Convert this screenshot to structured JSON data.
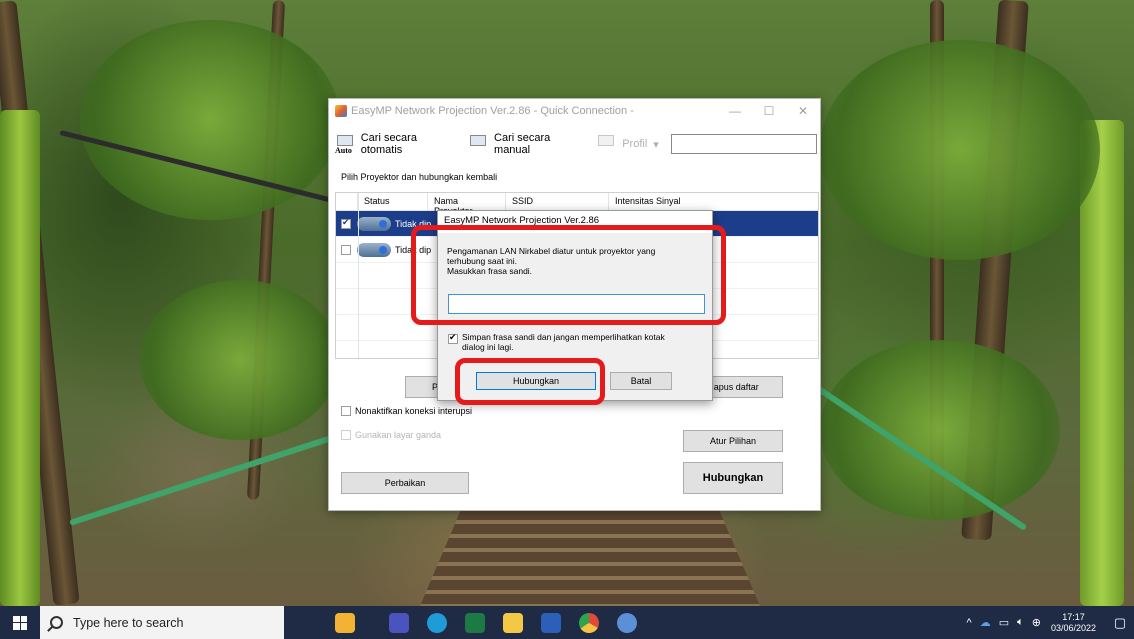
{
  "window": {
    "title": "EasyMP Network Projection Ver.2.86 - Quick Connection -",
    "controls": [
      "—",
      "☐",
      "✕"
    ]
  },
  "toolbar": {
    "auto_search": {
      "label": "Cari secara otomatis",
      "icon_text": "Auto"
    },
    "manual_search": {
      "label": "Cari secara manual"
    },
    "profile": {
      "label": "Profil",
      "arrow": "▾"
    }
  },
  "list": {
    "caption": "Pilih Proyektor dan hubungkan kembali",
    "columns": [
      "Status",
      "Nama Proyektor",
      "SSID",
      "Intensitas Sinyal"
    ],
    "rows": [
      {
        "status": "Tidak dip",
        "checked": true,
        "selected": true
      },
      {
        "status": "Tidak dip",
        "checked": false,
        "selected": false
      }
    ]
  },
  "buttons": {
    "partial_left": "P",
    "clear_list": "Hapus daftar",
    "set_options": "Atur Pilihan",
    "repair": "Perbaikan",
    "connect": "Hubungkan"
  },
  "checkboxes": {
    "disable_interrupt": "Nonaktifkan koneksi interupsi",
    "dual_screen": "Gunakan layar ganda"
  },
  "dialog": {
    "title": "EasyMP Network Projection Ver.2.86",
    "message_line1": "Pengamanan LAN Nirkabel diatur untuk proyektor yang",
    "message_line2": "terhubung saat ini.",
    "message_line3": "Masukkan frasa sandi.",
    "passphrase_value": "",
    "save_label_line1": "Simpan frasa sandi dan jangan memperlihatkan kotak",
    "save_label_line2": "dialog ini lagi.",
    "connect": "Hubungkan",
    "cancel": "Batal"
  },
  "taskbar": {
    "search_placeholder": "Type here to search",
    "time": "17:17",
    "date": "03/06/2022",
    "apps": [
      {
        "name": "weather-app",
        "color": "#f2b233"
      },
      {
        "name": "teams",
        "color": "#4b53bc"
      },
      {
        "name": "edge",
        "color": "#1f9bd7"
      },
      {
        "name": "excel-like",
        "color": "#1d7a45"
      },
      {
        "name": "file-explorer",
        "color": "#f3c845"
      },
      {
        "name": "word",
        "color": "#2b5fb8"
      },
      {
        "name": "chrome",
        "color": "#e04a3a"
      },
      {
        "name": "easymp",
        "color": "#5b8fd6"
      }
    ]
  },
  "colors": {
    "selection": "#1c3d8a",
    "highlight_box": "#e51b1b",
    "taskbar": "#1f2a44"
  }
}
